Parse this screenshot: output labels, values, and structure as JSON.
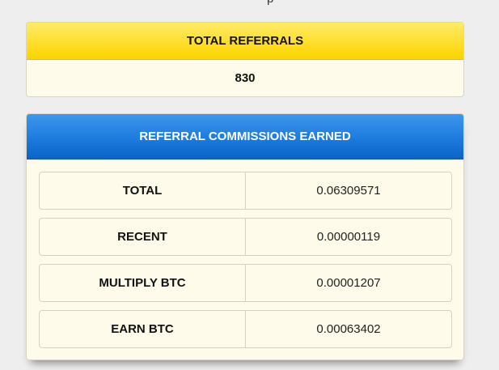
{
  "top_text": "p",
  "referrals": {
    "title": "TOTAL REFERRALS",
    "count": "830"
  },
  "commissions": {
    "title": "REFERRAL COMMISSIONS EARNED",
    "rows": [
      {
        "label": "TOTAL",
        "value": "0.06309571"
      },
      {
        "label": "RECENT",
        "value": "0.00000119"
      },
      {
        "label": "MULTIPLY BTC",
        "value": "0.00001207"
      },
      {
        "label": "EARN BTC",
        "value": "0.00063402"
      }
    ]
  },
  "colors": {
    "yellow_header": "#ffdf2c",
    "blue_header": "#1f7ee0",
    "panel_background": "#fefbea",
    "page_background": "#eeeeee"
  }
}
